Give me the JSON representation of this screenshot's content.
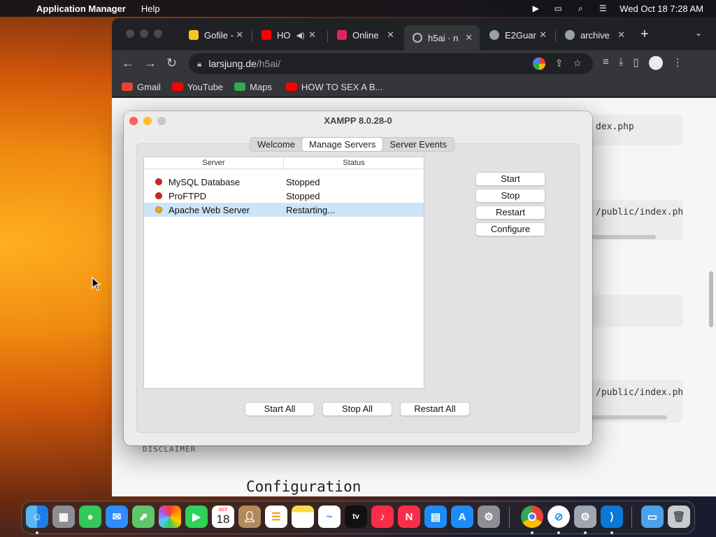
{
  "menubar": {
    "app_name": "Application Manager",
    "menus": [
      "Help"
    ],
    "datetime": "Wed Oct 18  7:28 AM"
  },
  "browser": {
    "tabs": [
      {
        "label": "Gofile -",
        "favicon_color": "#f3c623"
      },
      {
        "label": "HO",
        "favicon_color": "#ff0000"
      },
      {
        "label": "Online",
        "favicon_color": "#e0245e"
      },
      {
        "label": "h5ai · n",
        "favicon_color": "#9aa0a6"
      },
      {
        "label": "E2Guar",
        "favicon_color": "#9aa0a6"
      },
      {
        "label": "archive",
        "favicon_color": "#9aa0a6"
      }
    ],
    "url_domain": "larsjung.de",
    "url_path": "/h5ai/",
    "bookmarks": [
      {
        "label": "Gmail",
        "icon": "gmail-icon",
        "color": "#ea4335"
      },
      {
        "label": "YouTube",
        "icon": "youtube-icon",
        "color": "#ff0000"
      },
      {
        "label": "Maps",
        "icon": "maps-icon",
        "color": "#34a853"
      },
      {
        "label": "HOW TO SEX A B...",
        "icon": "youtube-icon",
        "color": "#ff0000"
      }
    ]
  },
  "page": {
    "code_snippets": [
      "dex.php",
      "/public/index.ph",
      "/public/index.ph"
    ],
    "disclaimer": "DISCLAIMER",
    "heading": "Configuration"
  },
  "xampp": {
    "title": "XAMPP 8.0.28-0",
    "tabs": [
      "Welcome",
      "Manage Servers",
      "Server Events"
    ],
    "active_tab": "Manage Servers",
    "columns": [
      "Server",
      "Status"
    ],
    "servers": [
      {
        "name": "MySQL Database",
        "status": "Stopped",
        "indicator": "#d0281f"
      },
      {
        "name": "ProFTPD",
        "status": "Stopped",
        "indicator": "#d0281f"
      },
      {
        "name": "Apache Web Server",
        "status": "Restarting...",
        "indicator": "#f0a821"
      }
    ],
    "side_buttons": [
      "Start",
      "Stop",
      "Restart",
      "Configure"
    ],
    "bottom_buttons": [
      "Start All",
      "Stop All",
      "Restart All"
    ]
  },
  "dock": {
    "apps": [
      "Finder",
      "Launchpad",
      "Messages",
      "Mail",
      "Maps",
      "Photos",
      "FaceTime",
      "Calendar",
      "Contacts",
      "Reminders",
      "Notes",
      "Freeform",
      "TV",
      "Music",
      "News",
      "Keynote",
      "App Store",
      "System Settings",
      "Chrome",
      "Safari",
      "XAMPP",
      "VS Code",
      "Downloads",
      "Trash"
    ],
    "calendar_month": "OCT",
    "calendar_day": "18",
    "tv_label": "tv"
  }
}
